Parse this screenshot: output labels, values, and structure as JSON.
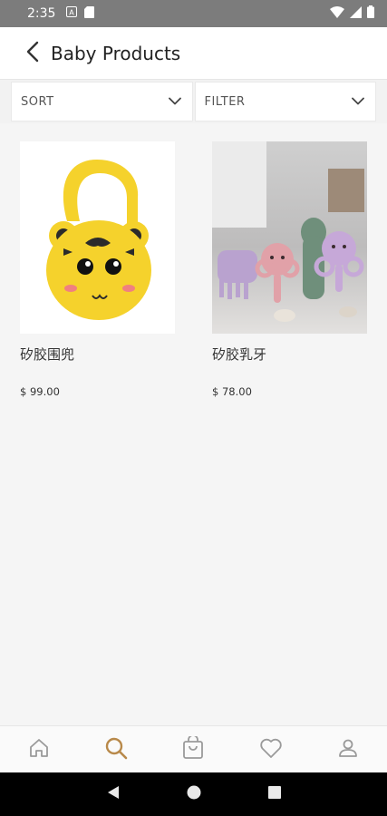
{
  "status_bar": {
    "time": "2:35"
  },
  "header": {
    "title": "Baby Products"
  },
  "controls": {
    "sort_label": "SORT",
    "filter_label": "FILTER"
  },
  "products": [
    {
      "name": "矽胶围兜",
      "price": "$ 99.00"
    },
    {
      "name": "矽胶乳牙",
      "price": "$ 78.00"
    }
  ],
  "bottom_nav": {
    "items": [
      "home-icon",
      "search-icon",
      "cart-icon",
      "wishlist-icon",
      "account-icon"
    ],
    "active": "search-icon",
    "active_color": "#b8894a",
    "inactive_color": "#9a9a9a"
  }
}
